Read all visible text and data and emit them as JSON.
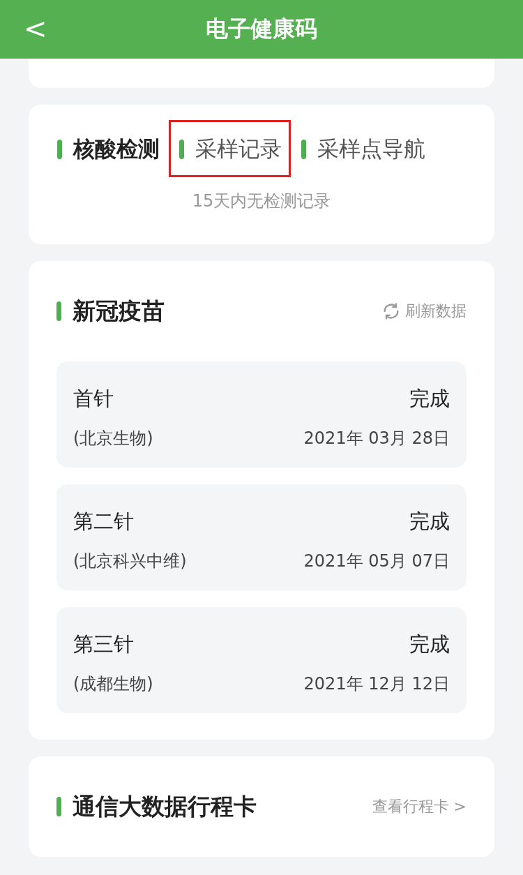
{
  "header": {
    "back_icon": "<",
    "title": "电子健康码"
  },
  "nucleic": {
    "tabs": [
      {
        "label": "核酸检测",
        "selected": true,
        "highlighted": false
      },
      {
        "label": "采样记录",
        "selected": false,
        "highlighted": true
      },
      {
        "label": "采样点导航",
        "selected": false,
        "highlighted": false
      }
    ],
    "empty_text": "15天内无检测记录"
  },
  "vaccine": {
    "title": "新冠疫苗",
    "refresh": "刷新数据",
    "doses": [
      {
        "name": "首针",
        "status": "完成",
        "maker": "(北京生物)",
        "date": "2021年 03月 28日"
      },
      {
        "name": "第二针",
        "status": "完成",
        "maker": "(北京科兴中维)",
        "date": "2021年 05月 07日"
      },
      {
        "name": "第三针",
        "status": "完成",
        "maker": "(成都生物)",
        "date": "2021年 12月 12日"
      }
    ]
  },
  "trip": {
    "title": "通信大数据行程卡",
    "link": "查看行程卡 >"
  }
}
